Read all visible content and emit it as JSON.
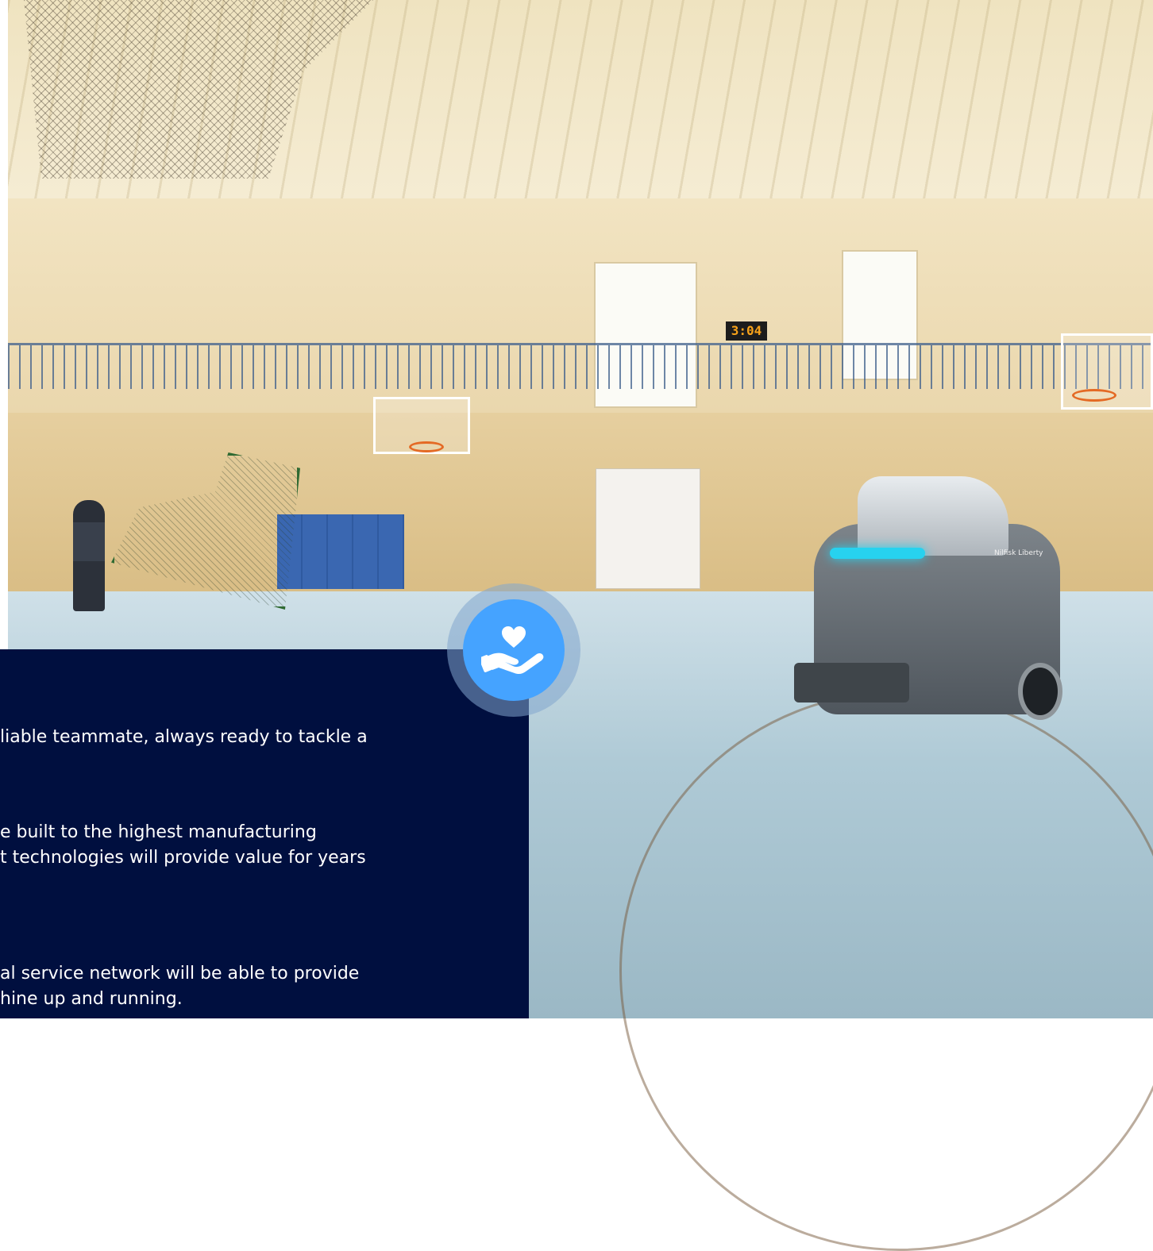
{
  "scene": {
    "shot_clock": "3:04",
    "robot_brand": "Nilfisk Liberty"
  },
  "feature_panel": {
    "lines": [
      {
        "text": "liable teammate, always ready to tackle a"
      },
      {
        "text": "e built to the highest manufacturing"
      },
      {
        "text": "t technologies will provide value for years"
      },
      {
        "text": "al service network will be able to provide"
      },
      {
        "text": "hine up and running."
      }
    ],
    "icon": "hand-heart-icon"
  },
  "colors": {
    "panel_bg": "#000f3f",
    "badge_blue": "#45a3ff",
    "badge_ring": "#82a5cd"
  }
}
